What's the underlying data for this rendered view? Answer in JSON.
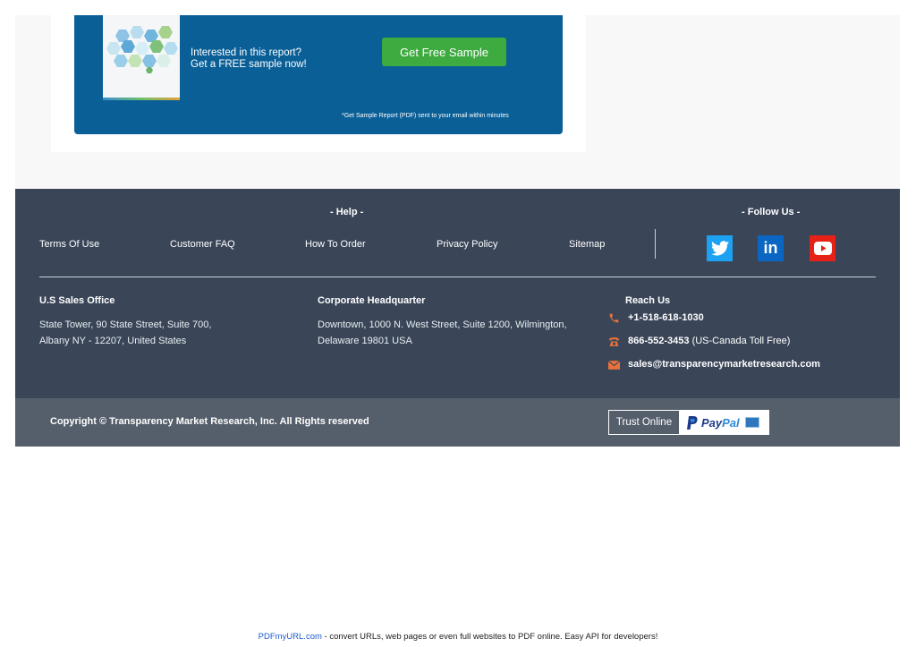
{
  "banner": {
    "line1": "Interested in this report?",
    "line2": "Get a FREE sample now!",
    "button_label": "Get Free Sample",
    "note": "*Get Sample Report (PDF) sent to your email within minutes"
  },
  "footer": {
    "help_heading": "- Help -",
    "follow_heading": "- Follow Us -",
    "links": [
      {
        "label": "Terms Of Use"
      },
      {
        "label": "Customer FAQ"
      },
      {
        "label": "How To Order"
      },
      {
        "label": "Privacy Policy"
      },
      {
        "label": "Sitemap"
      }
    ],
    "social": [
      {
        "name": "twitter",
        "color": "#1da1f2"
      },
      {
        "name": "linkedin",
        "color": "#0a66c2",
        "text": "in"
      },
      {
        "name": "youtube",
        "color": "#e62117"
      }
    ],
    "us_office": {
      "heading": "U.S Sales Office",
      "line1": "State Tower, 90 State Street, Suite 700,",
      "line2": "Albany NY - 12207, United States"
    },
    "hq": {
      "heading": "Corporate Headquarter",
      "line1": "Downtown, 1000 N. West Street, Suite 1200, Wilmington,",
      "line2": "Delaware 19801 USA"
    },
    "reach": {
      "heading": "Reach Us",
      "phone": "+1-518-618-1030",
      "tollfree_number": "866-552-3453",
      "tollfree_note": "(US-Canada Toll Free)",
      "email": "sales@transparencymarketresearch.com",
      "icon_color": "#e8723a"
    }
  },
  "copyright": {
    "text": "Copyright © Transparency Market Research, Inc. All Rights reserved",
    "trust_label": "Trust Online",
    "paypal_pay": "Pay",
    "paypal_pal": "Pal"
  },
  "pdf_footer": {
    "link_text": "PDFmyURL.com",
    "text": " - convert URLs, web pages or even full websites to PDF online. Easy API for developers!"
  }
}
